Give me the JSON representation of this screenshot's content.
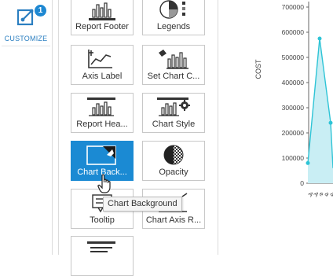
{
  "sidebar": {
    "customize_label": "CUSTOMIZE",
    "badge_count": "1",
    "icon": "customize-chart-icon"
  },
  "tiles": [
    {
      "label": "Report Footer",
      "icon": "report-footer-icon"
    },
    {
      "label": "Legends",
      "icon": "legends-icon"
    },
    {
      "label": "Axis Label",
      "icon": "axis-label-icon"
    },
    {
      "label": "Set Chart C...",
      "icon": "set-chart-color-icon"
    },
    {
      "label": "Report Hea...",
      "icon": "report-header-icon"
    },
    {
      "label": "Chart Style",
      "icon": "chart-style-icon"
    },
    {
      "label": "Chart Back...",
      "icon": "chart-background-icon",
      "selected": true
    },
    {
      "label": "Opacity",
      "icon": "opacity-icon"
    },
    {
      "label": "Tooltip",
      "icon": "tooltip-icon"
    },
    {
      "label": "Chart Axis R...",
      "icon": "chart-axis-rotation-icon"
    },
    {
      "label": "",
      "icon": "report-icon"
    }
  ],
  "tooltip": {
    "text": "Chart Background"
  },
  "colors": {
    "accent": "#1b8ad3",
    "series_line": "#2ec4d6",
    "series_fill": "#c9eef4",
    "badge": "#1e88d2"
  },
  "chart_data": {
    "type": "area",
    "ylabel": "COST",
    "ylim": [
      0,
      700000
    ],
    "yticks": [
      "700000",
      "600000",
      "500000",
      "400000",
      "300000",
      "200000",
      "100000",
      "0"
    ],
    "x_tick_labels": [
      "A",
      "A",
      "e",
      "a",
      "a"
    ],
    "series": [
      {
        "values": [
          80000,
          575000,
          240000
        ]
      }
    ]
  }
}
